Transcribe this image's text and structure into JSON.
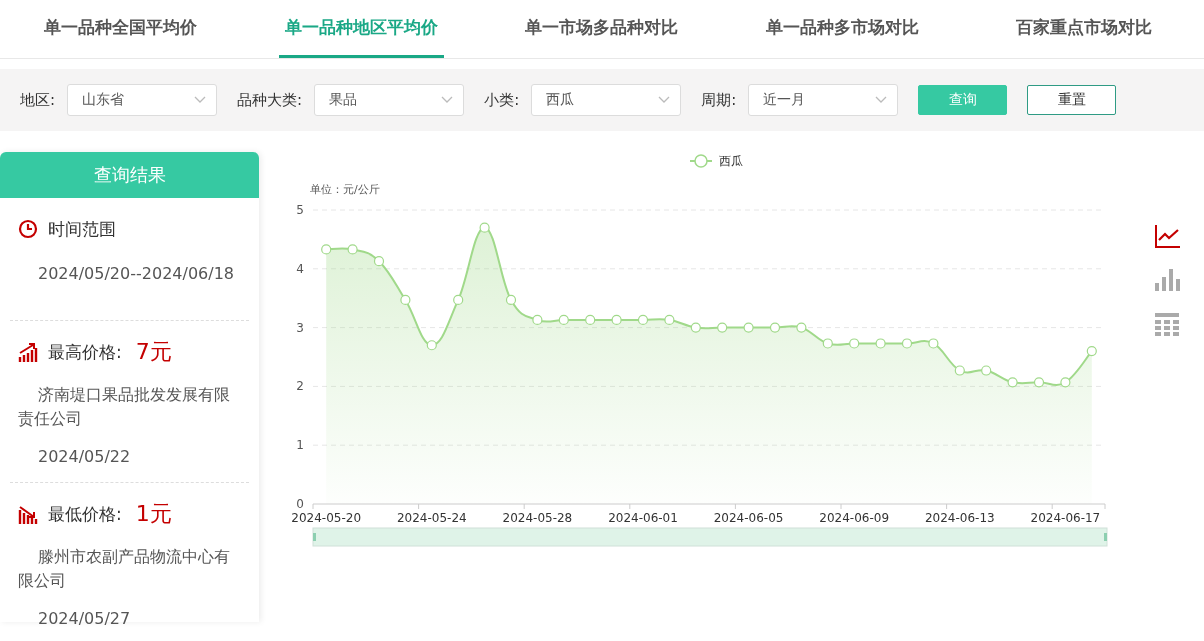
{
  "tabs": [
    {
      "label": "单一品种全国平均价",
      "selected": false
    },
    {
      "label": "单一品种地区平均价",
      "selected": true
    },
    {
      "label": "单一市场多品种对比",
      "selected": false
    },
    {
      "label": "单一品种多市场对比",
      "selected": false
    },
    {
      "label": "百家重点市场对比",
      "selected": false
    }
  ],
  "filters": [
    {
      "label": "地区:",
      "value": "山东省"
    },
    {
      "label": "品种大类:",
      "value": "果品"
    },
    {
      "label": "小类:",
      "value": "西瓜"
    },
    {
      "label": "周期:",
      "value": "近一月"
    }
  ],
  "buttons": [
    {
      "label": "查询",
      "kind": "primary"
    },
    {
      "label": "重置",
      "kind": "default"
    }
  ],
  "result_panel": {
    "title": "查询结果",
    "sections": [
      {
        "kind": "time",
        "heading": "时间范围",
        "text": "2024/05/20--2024/06/18"
      },
      {
        "kind": "max",
        "heading": "最高价格:",
        "price": "7元",
        "company": "济南堤口果品批发发展有限责任公司",
        "date": "2024/05/22"
      },
      {
        "kind": "min",
        "heading": "最低价格:",
        "price": "1元",
        "company": "滕州市农副产品物流中心有限公司",
        "date": "2024/05/27"
      }
    ]
  },
  "chart": {
    "unit": "单位：元/公斤",
    "chart_data": {
      "type": "area",
      "grid": true,
      "categories": [
        "2024-05-20",
        null,
        null,
        null,
        "2024-05-24",
        null,
        null,
        null,
        "2024-05-28",
        null,
        null,
        null,
        "2024-06-01",
        null,
        null,
        null,
        "2024-06-05",
        null,
        null,
        null,
        "2024-06-09",
        null,
        null,
        null,
        "2024-06-13",
        null,
        null,
        null,
        "2024-06-17",
        null
      ],
      "series": [
        {
          "name": "西瓜",
          "color": "#a0d98a",
          "values": [
            4.33,
            4.33,
            4.13,
            3.47,
            2.7,
            3.47,
            4.7,
            3.47,
            3.13,
            3.13,
            3.13,
            3.13,
            3.13,
            3.13,
            3.0,
            3.0,
            3.0,
            3.0,
            3.0,
            2.73,
            2.73,
            2.73,
            2.73,
            2.73,
            2.27,
            2.27,
            2.07,
            2.07,
            2.07,
            2.6
          ]
        }
      ],
      "ylim": [
        0,
        5
      ],
      "yticks": [
        0,
        1,
        2,
        3,
        4,
        5
      ]
    }
  },
  "view_switch": [
    {
      "kind": "line",
      "selected": true
    },
    {
      "kind": "bar",
      "selected": false
    },
    {
      "kind": "table",
      "selected": false
    }
  ]
}
